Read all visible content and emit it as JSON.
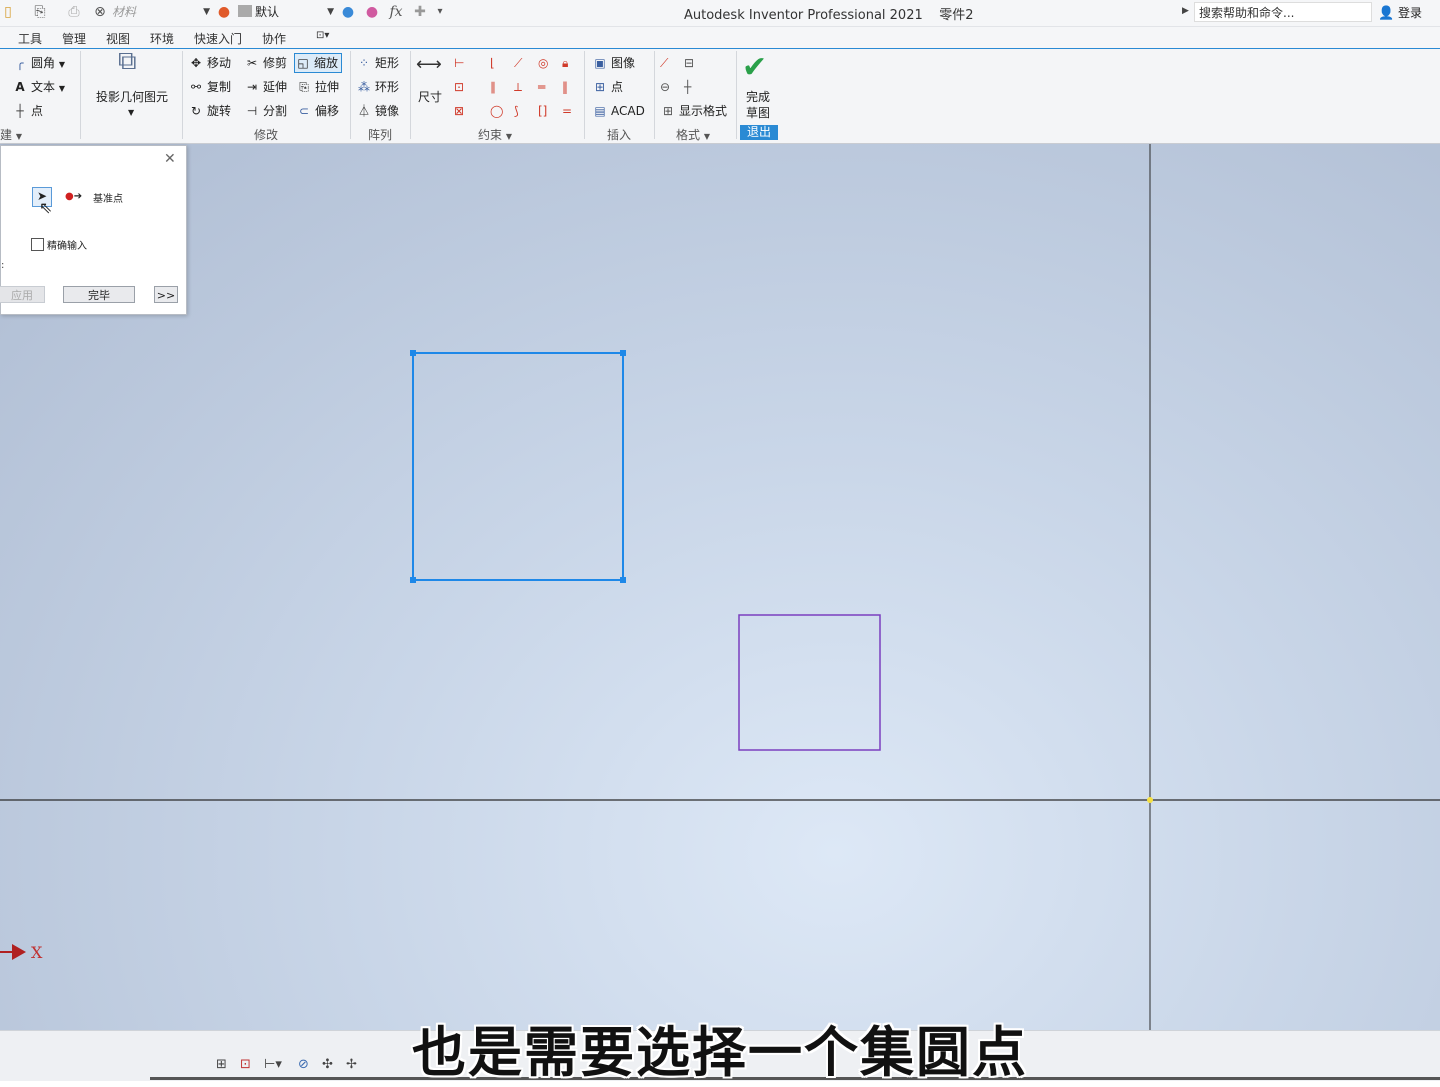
{
  "titlebar": {
    "material_placeholder": "材料",
    "appearance": "默认",
    "fx": "fx",
    "app_title": "Autodesk Inventor Professional 2021",
    "document": "零件2",
    "search_placeholder": "搜索帮助和命令...",
    "login": "登录"
  },
  "tabs": [
    "工具",
    "管理",
    "视图",
    "环境",
    "快速入门",
    "协作"
  ],
  "ribbon": {
    "create": {
      "fillet": "圆角",
      "text": "文本",
      "point": "点",
      "label": "建"
    },
    "project": {
      "label": "投影几何图元"
    },
    "modify": {
      "move": "移动",
      "trim": "修剪",
      "scale": "缩放",
      "copy": "复制",
      "extend": "延伸",
      "stretch": "拉伸",
      "rotate": "旋转",
      "split": "分割",
      "offset": "偏移",
      "label": "修改"
    },
    "pattern": {
      "rect": "矩形",
      "circular": "环形",
      "mirror": "镜像",
      "label": "阵列"
    },
    "dimension": {
      "label": "尺寸"
    },
    "constrain": {
      "label": "约束"
    },
    "insert": {
      "image": "图像",
      "point": "点",
      "acad": "ACAD",
      "label": "插入"
    },
    "format": {
      "show": "显示格式",
      "label": "格式"
    },
    "finish": {
      "line1": "完成",
      "line2": "草图",
      "exit": "退出"
    }
  },
  "dialog": {
    "base_point": "基准点",
    "precise_input": "精确输入",
    "apply": "应用",
    "done": "完毕",
    "more": ">>"
  },
  "canvas": {
    "axis_x": "X"
  },
  "subtitle": "也是需要选择一个集圆点",
  "colors": {
    "selected_rect": "#1e88e8",
    "scaled_rect": "#7b3fbf",
    "axis_line": "#2b2b2b",
    "accent": "#2a8ad4"
  }
}
